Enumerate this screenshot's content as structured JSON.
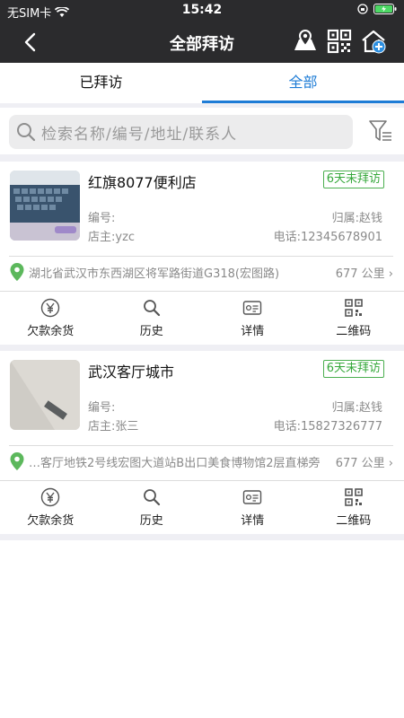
{
  "status_bar": {
    "carrier": "无SIM卡",
    "time": "15:42"
  },
  "nav": {
    "title": "全部拜访",
    "icons": [
      "map-icon",
      "qrcode-icon",
      "home-add-icon"
    ]
  },
  "tabs": [
    {
      "label": "已拜访",
      "active": false
    },
    {
      "label": "全部",
      "active": true
    }
  ],
  "search": {
    "placeholder": "检索名称/编号/地址/联系人"
  },
  "colors": {
    "accent": "#1e7cd6",
    "badge": "#36a83b",
    "nav_bg": "#2b2b2d"
  },
  "stores": [
    {
      "name": "红旗8077便利店",
      "badge": "6天未拜访",
      "code_label": "编号:",
      "owner_label": "店主:yzc",
      "belong_label": "归属:赵钱",
      "phone_label": "电话:12345678901",
      "address": "湖北省武汉市东西湖区将军路街道G318(宏图路)",
      "distance": "677 公里"
    },
    {
      "name": "武汉客厅城市",
      "badge": "6天未拜访",
      "code_label": "编号:",
      "owner_label": "店主:张三",
      "belong_label": "归属:赵钱",
      "phone_label": "电话:15827326777",
      "address": "…客厅地铁2号线宏图大道站B出口美食博物馆2层直梯旁",
      "distance": "677 公里"
    }
  ],
  "actions": [
    {
      "label": "欠款余货",
      "icon": "yen-icon"
    },
    {
      "label": "历史",
      "icon": "search-icon"
    },
    {
      "label": "详情",
      "icon": "detail-icon"
    },
    {
      "label": "二维码",
      "icon": "qrcode-icon"
    }
  ]
}
